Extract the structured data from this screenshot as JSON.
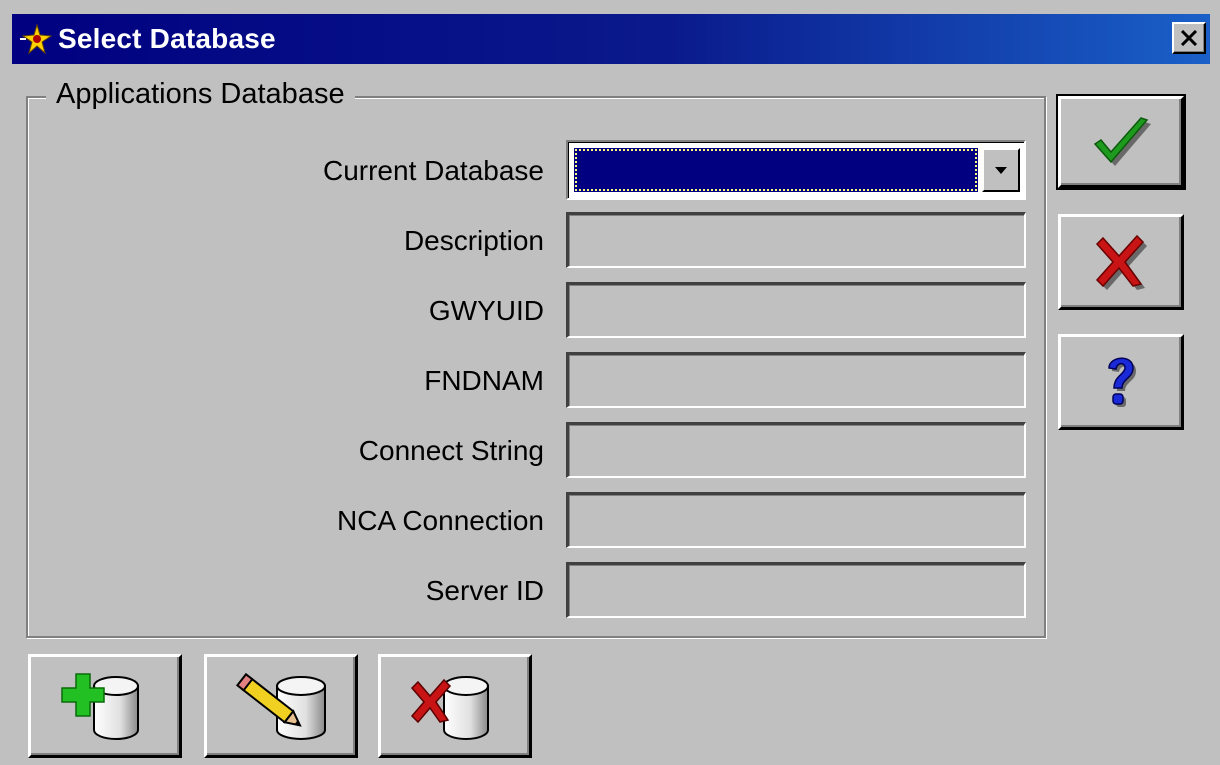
{
  "window": {
    "title": "Select Database",
    "title_icon": "app-sparkle-icon",
    "close_icon": "close-x-icon"
  },
  "group": {
    "legend": "Applications Database"
  },
  "form": {
    "current_database": {
      "label": "Current Database",
      "value": "",
      "arrow_icon": "dropdown-arrow-icon"
    },
    "fields": [
      {
        "name": "description",
        "label": "Description",
        "value": ""
      },
      {
        "name": "gwyuid",
        "label": "GWYUID",
        "value": ""
      },
      {
        "name": "fndnam",
        "label": "FNDNAM",
        "value": ""
      },
      {
        "name": "connect-string",
        "label": "Connect String",
        "value": ""
      },
      {
        "name": "nca-connection",
        "label": "NCA Connection",
        "value": ""
      },
      {
        "name": "server-id",
        "label": "Server ID",
        "value": ""
      }
    ]
  },
  "side_buttons": [
    {
      "name": "ok-button",
      "icon": "green-check-icon"
    },
    {
      "name": "cancel-button",
      "icon": "red-x-icon"
    },
    {
      "name": "help-button",
      "icon": "blue-question-icon"
    }
  ],
  "bottom_buttons": [
    {
      "name": "add-database-button",
      "icon": "database-add-icon"
    },
    {
      "name": "edit-database-button",
      "icon": "database-edit-icon"
    },
    {
      "name": "delete-database-button",
      "icon": "database-delete-icon"
    }
  ],
  "colors": {
    "titlebar_start": "#000080",
    "titlebar_end": "#1a60c8",
    "face": "#c0c0c0",
    "selection": "#000080",
    "check_green": "#1e9a1e",
    "x_red": "#c81414",
    "help_blue": "#1a2ad8"
  }
}
